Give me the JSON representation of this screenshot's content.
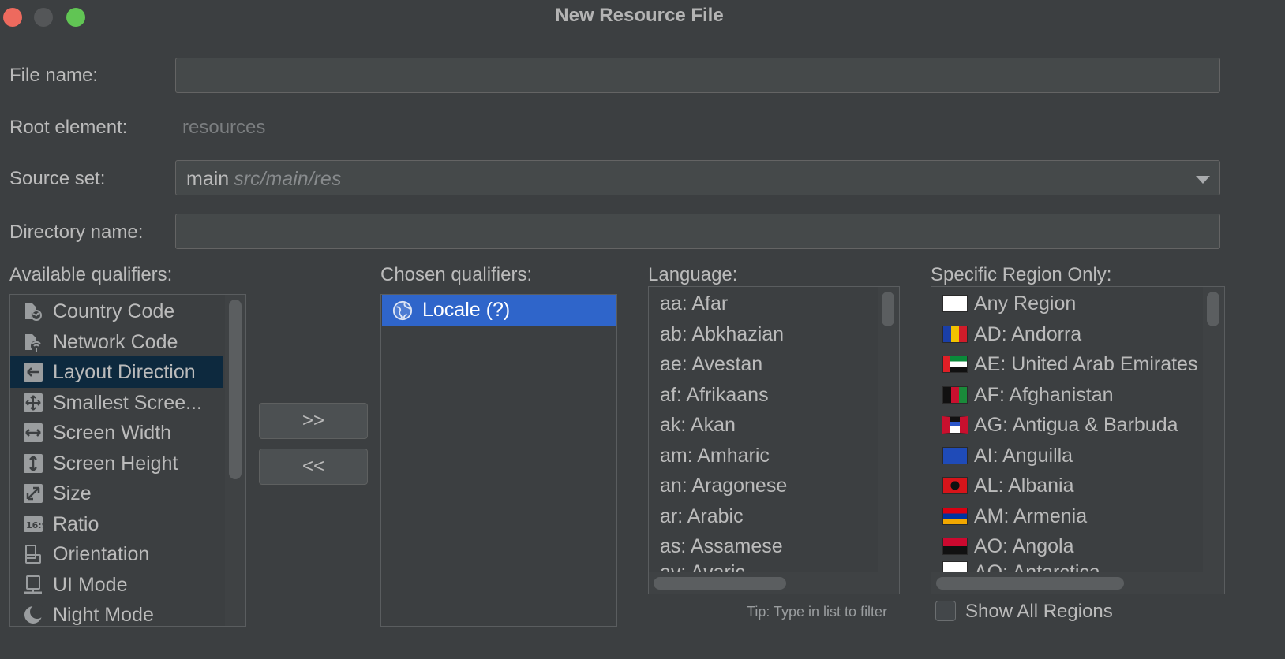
{
  "window": {
    "title": "New Resource File"
  },
  "form": {
    "file_name_label": "File name:",
    "file_name_value": "",
    "root_element_label": "Root element:",
    "root_element_value": "resources",
    "source_set_label": "Source set:",
    "source_set_main": "main",
    "source_set_path": "src/main/res",
    "directory_name_label": "Directory name:",
    "directory_name_value": ""
  },
  "qualifiers": {
    "available_label": "Available qualifiers:",
    "available_items": [
      {
        "label": "Country Code",
        "icon": "country-code-icon"
      },
      {
        "label": "Network Code",
        "icon": "network-code-icon"
      },
      {
        "label": "Layout Direction",
        "icon": "layout-direction-icon"
      },
      {
        "label": "Smallest Scree...",
        "icon": "smallest-screen-icon"
      },
      {
        "label": "Screen Width",
        "icon": "screen-width-icon"
      },
      {
        "label": "Screen Height",
        "icon": "screen-height-icon"
      },
      {
        "label": "Size",
        "icon": "size-icon"
      },
      {
        "label": "Ratio",
        "icon": "ratio-icon"
      },
      {
        "label": "Orientation",
        "icon": "orientation-icon"
      },
      {
        "label": "UI Mode",
        "icon": "ui-mode-icon"
      },
      {
        "label": "Night Mode",
        "icon": "night-mode-icon"
      }
    ],
    "add_button": ">>",
    "remove_button": "<<",
    "chosen_label": "Chosen qualifiers:",
    "chosen_items": [
      {
        "label": "Locale (?)",
        "icon": "globe-icon"
      }
    ]
  },
  "language": {
    "label": "Language:",
    "items": [
      "aa: Afar",
      "ab: Abkhazian",
      "ae: Avestan",
      "af: Afrikaans",
      "ak: Akan",
      "am: Amharic",
      "an: Aragonese",
      "ar: Arabic",
      "as: Assamese",
      "av: Avaric"
    ],
    "tip": "Tip: Type in list to filter"
  },
  "region": {
    "label": "Specific Region Only:",
    "items": [
      "Any Region",
      "AD: Andorra",
      "AE: United Arab Emirates",
      "AF: Afghanistan",
      "AG: Antigua & Barbuda",
      "AI: Anguilla",
      "AL: Albania",
      "AM: Armenia",
      "AO: Angola",
      "AQ: Antarctica"
    ],
    "show_all_label": "Show All Regions"
  },
  "colors": {
    "background": "#3c3f41",
    "selection": "#2f65ca",
    "selection_inactive": "#0d293e"
  }
}
